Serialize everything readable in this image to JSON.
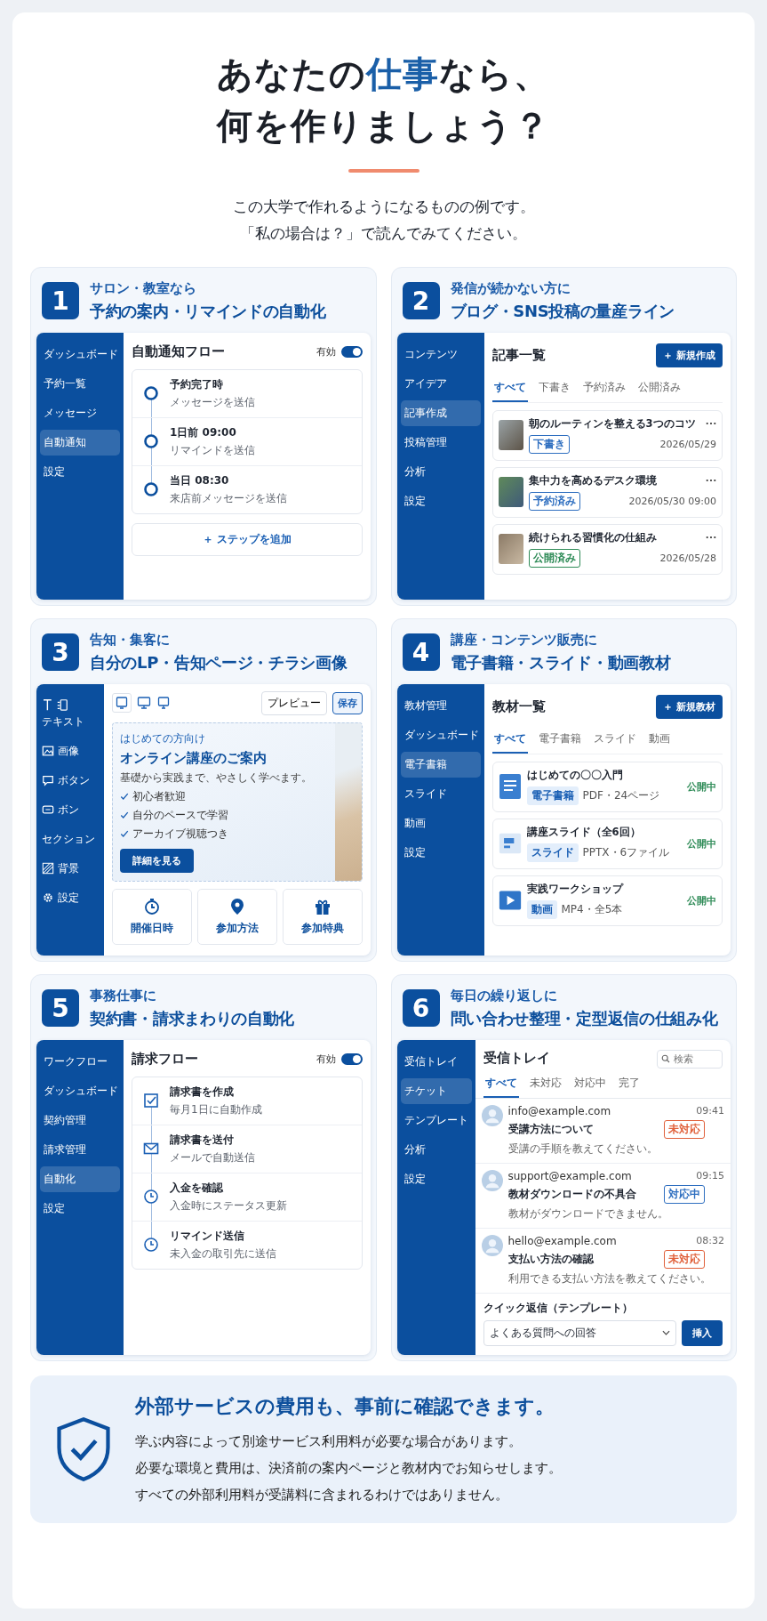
{
  "header": {
    "title_before": "あなたの",
    "title_accent": "仕事",
    "title_after": "なら、",
    "title_line2": "何を作りましょう？",
    "intro": [
      "この大学で作れるようになるものの例です。",
      "「私の場合は？」で読んでみてください。"
    ]
  },
  "cards": [
    {
      "number": "1",
      "lead": "サロン・教室なら",
      "title": "予約の案内・リマインドの自動化",
      "kind": "flow",
      "sidebar": [
        {
          "label": "ダッシュボード",
          "selected": false
        },
        {
          "label": "予約一覧",
          "selected": false
        },
        {
          "label": "メッセージ",
          "selected": false
        },
        {
          "label": "自動通知",
          "selected": true
        },
        {
          "label": "設定",
          "selected": false
        }
      ],
      "panel": {
        "title": "自動通知フロー",
        "toggle_label": "有効",
        "on": true,
        "steps": [
          {
            "kind": "ring",
            "title": "予約完了時",
            "detail": "メッセージを送信"
          },
          {
            "kind": "ring",
            "title": "1日前 09:00",
            "detail": "リマインドを送信"
          },
          {
            "kind": "ring",
            "title": "当日 08:30",
            "detail": "来店前メッセージを送信"
          }
        ],
        "add_button": "＋ ステップを追加"
      }
    },
    {
      "number": "2",
      "lead": "発信が続かない方に",
      "title": "ブログ・SNS投稿の量産ライン",
      "kind": "articles",
      "sidebar": [
        {
          "label": "コンテンツ",
          "selected": false
        },
        {
          "label": "アイデア",
          "selected": false
        },
        {
          "label": "記事作成",
          "selected": true
        },
        {
          "label": "投稿管理",
          "selected": false
        },
        {
          "label": "分析",
          "selected": false
        },
        {
          "label": "設定",
          "selected": false
        }
      ],
      "panel": {
        "title": "記事一覧",
        "new_button": "＋ 新規作成",
        "tabs": [
          {
            "label": "すべて",
            "selected": true
          },
          {
            "label": "下書き",
            "selected": false
          },
          {
            "label": "予約済み",
            "selected": false
          },
          {
            "label": "公開済み",
            "selected": false
          }
        ],
        "items": [
          {
            "title": "朝のルーティンを整える3つのコツ",
            "tag": "下書き",
            "color": "#2f6fc0",
            "date": "2026/05/29"
          },
          {
            "title": "集中力を高めるデスク環境",
            "tag": "予約済み",
            "color": "#2f6fc0",
            "date": "2026/05/30 09:00"
          },
          {
            "title": "続けられる習慣化の仕組み",
            "tag": "公開済み",
            "color": "#2e8b57",
            "date": "2026/05/28"
          }
        ]
      }
    },
    {
      "number": "3",
      "lead": "告知・集客に",
      "title": "自分のLP・告知ページ・チラシ画像",
      "kind": "editor",
      "tools": [
        {
          "kind": "text",
          "label": "テキスト"
        },
        {
          "kind": "image",
          "label": "画像"
        },
        {
          "kind": "bubble",
          "label": "ボタン"
        },
        {
          "kind": "button",
          "label": "ボン"
        },
        {
          "kind": "plain",
          "label": "セクション"
        },
        {
          "kind": "hatch",
          "label": "背景"
        },
        {
          "kind": "gear",
          "label": "設定"
        }
      ],
      "panel": {
        "preview_button": "プレビュー",
        "save_button": "保存",
        "hero": {
          "eyebrow": "はじめての方向け",
          "heading": "オンライン講座のご案内",
          "text": "基礎から実践まで、やさしく学べます。",
          "checks": [
            "初心者歓迎",
            "自分のペースで学習",
            "アーカイブ視聴つき"
          ],
          "cta": "詳細を見る"
        },
        "features": [
          {
            "kind": "clock",
            "label": "開催日時"
          },
          {
            "kind": "pin",
            "label": "参加方法"
          },
          {
            "kind": "gift",
            "label": "参加特典"
          }
        ]
      }
    },
    {
      "number": "4",
      "lead": "講座・コンテンツ販売に",
      "title": "電子書籍・スライド・動画教材",
      "kind": "materials",
      "sidebar": [
        {
          "label": "教材管理",
          "selected": false
        },
        {
          "label": "ダッシュボード",
          "selected": false
        },
        {
          "label": "電子書籍",
          "selected": true
        },
        {
          "label": "スライド",
          "selected": false
        },
        {
          "label": "動画",
          "selected": false
        },
        {
          "label": "設定",
          "selected": false
        }
      ],
      "panel": {
        "title": "教材一覧",
        "new_button": "＋ 新規教材",
        "tabs": [
          {
            "label": "すべて",
            "selected": true
          },
          {
            "label": "電子書籍",
            "selected": false
          },
          {
            "label": "スライド",
            "selected": false
          },
          {
            "label": "動画",
            "selected": false
          }
        ],
        "items": [
          {
            "kind": "document",
            "title": "はじめての〇〇入門",
            "tag": "電子書籍",
            "meta": "PDF・24ページ",
            "status": "公開中"
          },
          {
            "kind": "slides",
            "title": "講座スライド（全6回）",
            "tag": "スライド",
            "meta": "PPTX・6ファイル",
            "status": "公開中"
          },
          {
            "kind": "video",
            "title": "実践ワークショップ",
            "tag": "動画",
            "meta": "MP4・全5本",
            "status": "公開中"
          }
        ]
      }
    },
    {
      "number": "5",
      "lead": "事務仕事に",
      "title": "契約書・請求まわりの自動化",
      "kind": "flow",
      "sidebar": [
        {
          "label": "ワークフロー",
          "selected": false
        },
        {
          "label": "ダッシュボード",
          "selected": false
        },
        {
          "label": "契約管理",
          "selected": false
        },
        {
          "label": "請求管理",
          "selected": false
        },
        {
          "label": "自動化",
          "selected": true
        },
        {
          "label": "設定",
          "selected": false
        }
      ],
      "panel": {
        "title": "請求フロー",
        "toggle_label": "有効",
        "on": true,
        "steps": [
          {
            "kind": "check",
            "title": "請求書を作成",
            "detail": "毎月1日に自動作成"
          },
          {
            "kind": "mail",
            "title": "請求書を送付",
            "detail": "メールで自動送信"
          },
          {
            "kind": "clock",
            "title": "入金を確認",
            "detail": "入金時にステータス更新"
          },
          {
            "kind": "clock",
            "title": "リマインド送信",
            "detail": "未入金の取引先に送信"
          }
        ]
      }
    },
    {
      "number": "6",
      "lead": "毎日の繰り返しに",
      "title": "問い合わせ整理・定型返信の仕組み化",
      "kind": "inbox",
      "sidebar": [
        {
          "label": "受信トレイ",
          "selected": false
        },
        {
          "label": "チケット",
          "selected": true
        },
        {
          "label": "テンプレート",
          "selected": false
        },
        {
          "label": "分析",
          "selected": false
        },
        {
          "label": "設定",
          "selected": false
        }
      ],
      "panel": {
        "title": "受信トレイ",
        "search_placeholder": "検索",
        "tabs": [
          {
            "label": "すべて",
            "selected": true
          },
          {
            "label": "未対応",
            "selected": false
          },
          {
            "label": "対応中",
            "selected": false
          },
          {
            "label": "完了",
            "selected": false
          }
        ],
        "messages": [
          {
            "from": "info@example.com",
            "time": "09:41",
            "subject": "受講方法について",
            "status": "未対応",
            "color": "#e0603a",
            "preview": "受講の手順を教えてください。"
          },
          {
            "from": "support@example.com",
            "time": "09:15",
            "subject": "教材ダウンロードの不具合",
            "status": "対応中",
            "color": "#2f6fc0",
            "preview": "教材がダウンロードできません。"
          },
          {
            "from": "hello@example.com",
            "time": "08:32",
            "subject": "支払い方法の確認",
            "status": "未対応",
            "color": "#e0603a",
            "preview": "利用できる支払い方法を教えてください。"
          }
        ],
        "quick_reply_label": "クイック返信（テンプレート）",
        "template_value": "よくある質問への回答",
        "insert_button": "挿入"
      }
    }
  ],
  "notice": {
    "title": "外部サービスの費用も、事前に確認できます。",
    "lines": [
      "学ぶ内容によって別途サービス利用料が必要な場合があります。",
      "必要な環境と費用は、決済前の案内ページと教材内でお知らせします。",
      "すべての外部利用料が受講料に含まれるわけではありません。"
    ]
  }
}
